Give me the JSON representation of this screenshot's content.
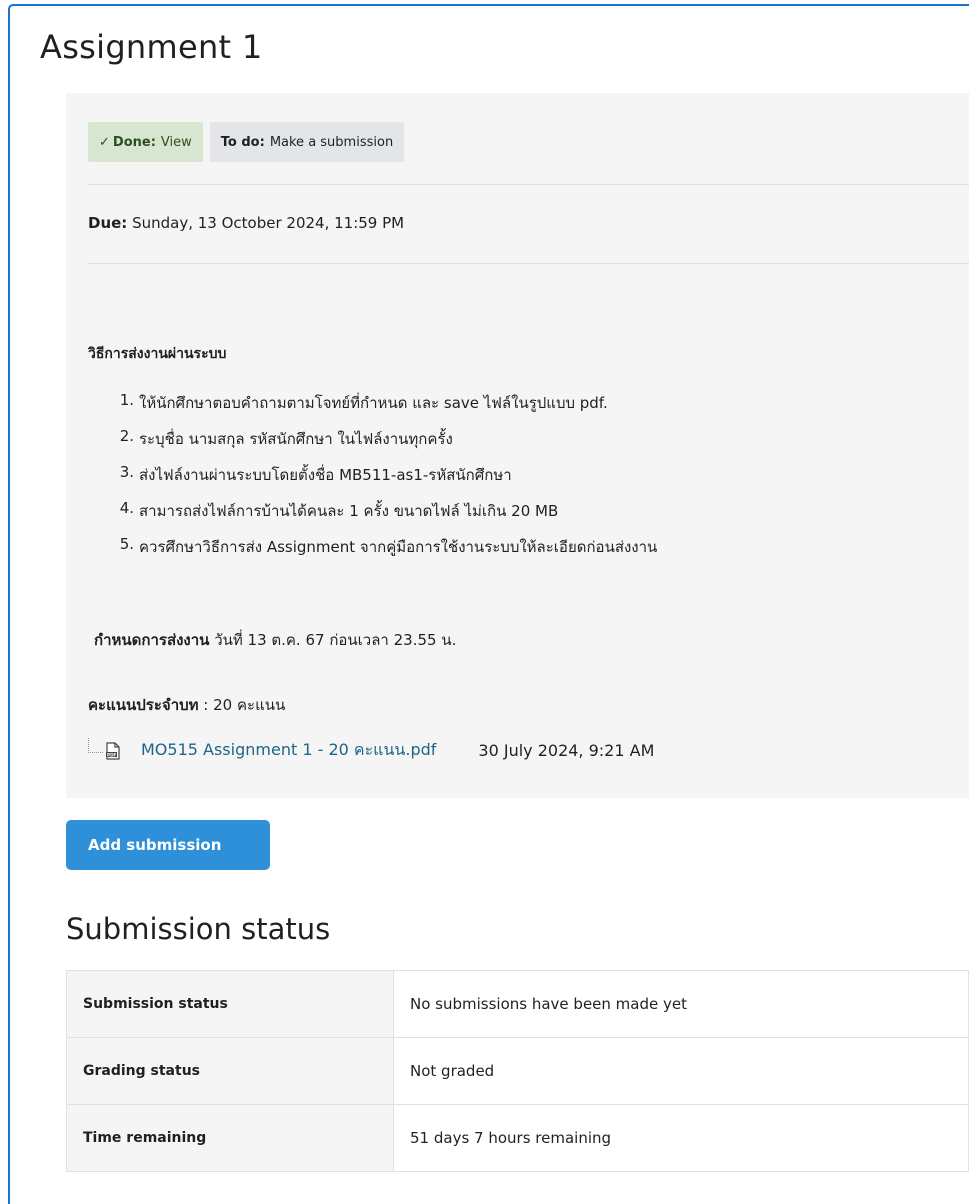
{
  "page": {
    "title": "Assignment 1"
  },
  "completion": {
    "done": {
      "label": "Done:",
      "value": "View"
    },
    "todo": {
      "label": "To do:",
      "value": "Make a submission"
    }
  },
  "due": {
    "label": "Due:",
    "value": "Sunday, 13 October 2024, 11:59 PM"
  },
  "instructions": {
    "heading": "วิธีการส่งงานผ่านระบบ",
    "steps": [
      "ให้นักศึกษาตอบคำถามตามโจทย์ที่กำหนด และ save ไฟล์ในรูปแบบ pdf.",
      "ระบุชื่อ นามสกุล รหัสนักศึกษา ในไฟล์งานทุกครั้ง",
      "ส่งไฟล์งานผ่านระบบโดยตั้งชื่อ MB511-as1-รหัสนักศึกษา",
      "สามารถส่งไฟล์การบ้านได้คนละ 1 ครั้ง ขนาดไฟล์ ไม่เกิน 20 MB",
      "ควรศึกษาวิธีการส่ง Assignment จากคู่มือการใช้งานระบบให้ละเอียดก่อนส่งงาน"
    ],
    "deadline_label": "กำหนดการส่งงาน",
    "deadline_value": " วันที่ 13 ต.ค. 67 ก่อนเวลา 23.55 น.",
    "score_label": "คะแนนประจำบท",
    "score_value": " : 20 คะแนน"
  },
  "attachment": {
    "icon": "pdf-file-icon",
    "name": "MO515 Assignment 1 - 20 คะแนน.pdf",
    "date": "30 July 2024, 9:21 AM"
  },
  "add_submission_label": "Add submission",
  "submission_status": {
    "title": "Submission status",
    "rows": [
      {
        "label": "Submission status",
        "value": "No submissions have been made yet"
      },
      {
        "label": "Grading status",
        "value": "Not graded"
      },
      {
        "label": "Time remaining",
        "value": "51 days 7 hours remaining"
      }
    ]
  },
  "colors": {
    "accent": "#2d90d8",
    "done_bg": "#d7e6d0",
    "todo_bg": "#e3e5e8",
    "link": "#1f6489"
  }
}
